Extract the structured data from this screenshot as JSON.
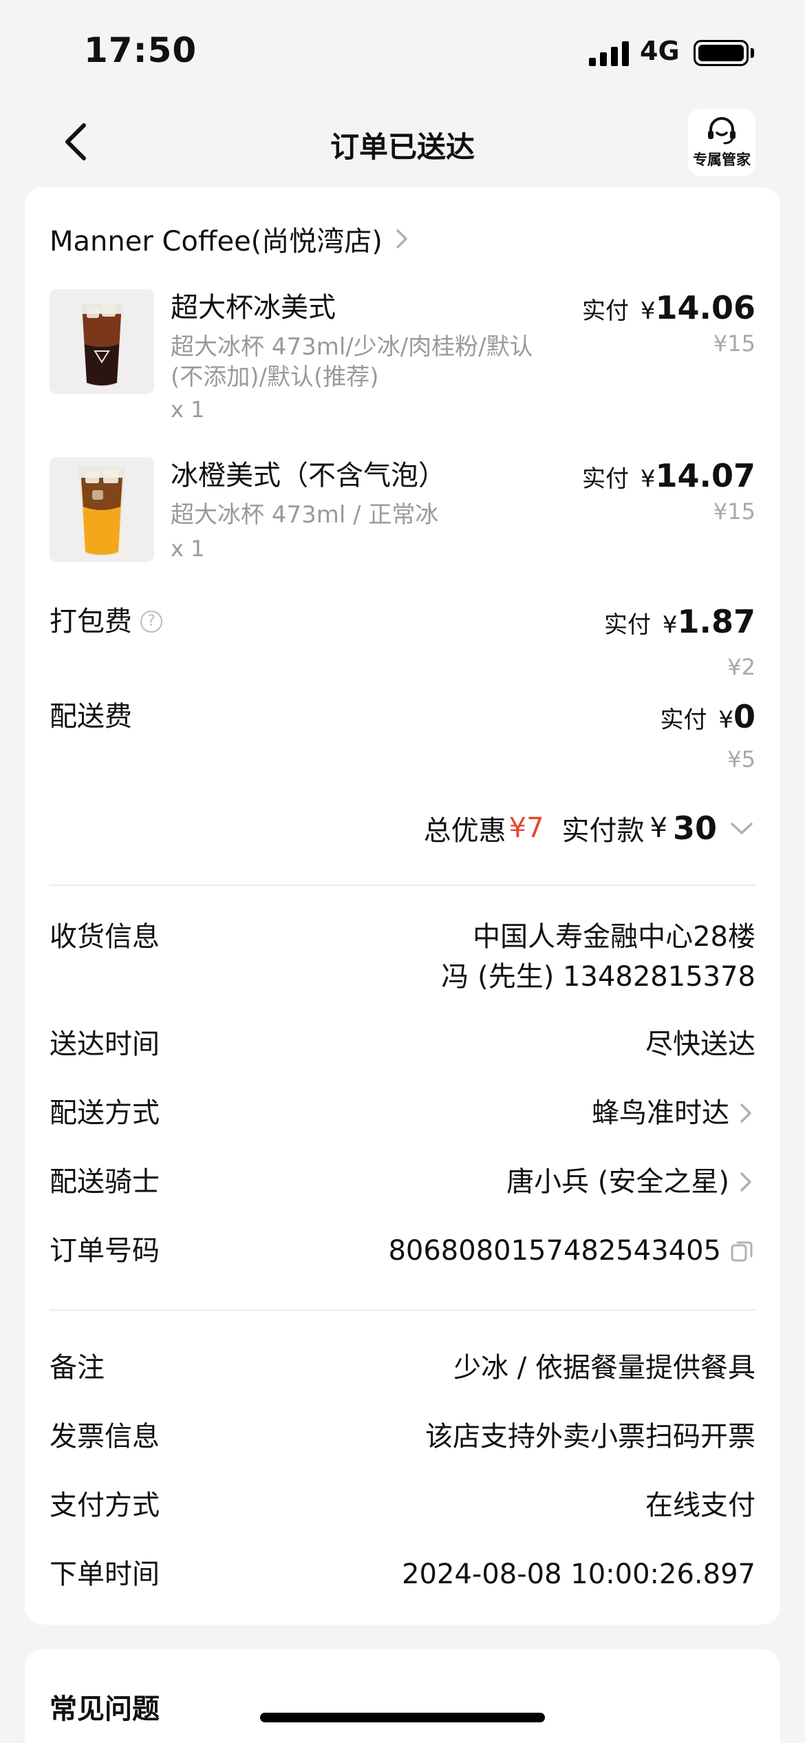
{
  "status_bar": {
    "time": "17:50",
    "network": "4G",
    "battery_level": 1.0
  },
  "nav": {
    "title": "订单已送达",
    "butler_label": "专属管家"
  },
  "store": {
    "name": "Manner Coffee(尚悦湾店)"
  },
  "items": [
    {
      "name": "超大杯冰美式",
      "spec": "超大冰杯 473ml/少冰/肉桂粉/默认(不添加)/默认(推荐)",
      "qty": "x 1",
      "paid_label": "实付",
      "currency": "¥",
      "paid": "14.06",
      "original": "¥15",
      "image": "iced-americano-image"
    },
    {
      "name": "冰橙美式（不含气泡）",
      "spec": "超大冰杯 473ml / 正常冰",
      "qty": "x 1",
      "paid_label": "实付",
      "currency": "¥",
      "paid": "14.07",
      "original": "¥15",
      "image": "iced-orange-americano-image"
    }
  ],
  "fees": [
    {
      "label": "打包费",
      "has_help_icon": true,
      "paid_label": "实付",
      "currency": "¥",
      "paid": "1.87",
      "original": "¥2"
    },
    {
      "label": "配送费",
      "has_help_icon": false,
      "paid_label": "实付",
      "currency": "¥",
      "paid": "0",
      "original": "¥5"
    }
  ],
  "totals": {
    "discount_label": "总优惠",
    "discount": "¥7",
    "paid_label": "实付款",
    "currency": "¥",
    "paid": "30"
  },
  "delivery": {
    "address_label": "收货信息",
    "address": "中国人寿金融中心28楼",
    "contact": "冯 (先生) 13482815378",
    "time_label": "送达时间",
    "time": "尽快送达",
    "method_label": "配送方式",
    "method": "蜂鸟准时达",
    "rider_label": "配送骑士",
    "rider": "唐小兵 (安全之星)",
    "order_no_label": "订单号码",
    "order_no": "8068080157482543405"
  },
  "extra": {
    "note_label": "备注",
    "note": "少冰 / 依据餐量提供餐具",
    "invoice_label": "发票信息",
    "invoice": "该店支持外卖小票扫码开票",
    "payment_label": "支付方式",
    "payment": "在线支付",
    "order_time_label": "下单时间",
    "order_time": "2024-08-08 10:00:26.897"
  },
  "faq": {
    "title": "常见问题"
  },
  "colors": {
    "accent_red": "#e8452e",
    "muted": "#9a9a9a",
    "background": "#f4f4f4"
  }
}
